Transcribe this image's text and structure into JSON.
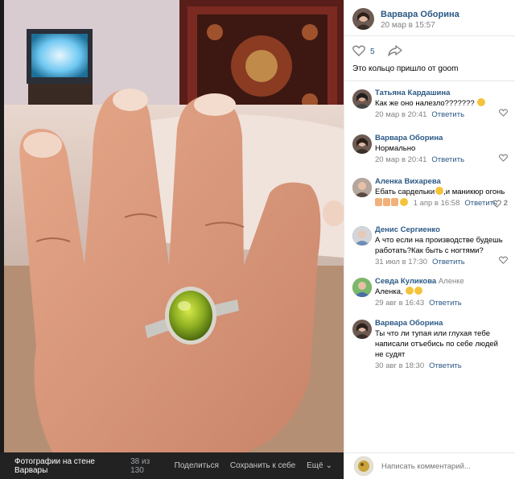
{
  "post": {
    "author_name": "Варвара Оборина",
    "date": "20 мар в 15:57",
    "likes": "5",
    "caption": "Это кольцо пришло от goom"
  },
  "comments": [
    {
      "name": "Татьяна Кардашина",
      "reply_to": "",
      "text": "Как же оно налезло???????",
      "date": "20 мар в 20:41",
      "reply": "Ответить",
      "likes": ""
    },
    {
      "name": "Варвара Оборина",
      "reply_to": "",
      "text": "Нормально",
      "date": "20 мар в 20:41",
      "reply": "Ответить",
      "likes": ""
    },
    {
      "name": "Аленка Вихарева",
      "reply_to": "",
      "text": "Ебать сардельки",
      "text2": ",и маникюр огонь",
      "date": "1 апр в 16:58",
      "reply": "Ответить",
      "likes": "2"
    },
    {
      "name": "Денис Сергиенко",
      "reply_to": "",
      "text": "А что если на производстве будешь работать?Как быть с ногтями?",
      "date": "31 июл в 17:30",
      "reply": "Ответить",
      "likes": ""
    },
    {
      "name": "Севда Куликова",
      "reply_to": "Аленке",
      "text": "Аленка,",
      "date": "29 авг в 16:43",
      "reply": "Ответить",
      "likes": ""
    },
    {
      "name": "Варвара Оборина",
      "reply_to": "",
      "text": "Ты что ли тупая или глухая тебе написали отъебись по себе людей не судят",
      "date": "30 авг в 18:30",
      "reply": "Ответить",
      "likes": ""
    }
  ],
  "viewer": {
    "album_title": "Фотографии на стене Варвары",
    "counter": "38 из 130",
    "share": "Поделиться",
    "save": "Сохранить к себе",
    "more": "Ещё"
  },
  "compose": {
    "placeholder": "Написать комментарий..."
  },
  "icons": {
    "like": "heart-icon",
    "share": "share-arrow-icon",
    "comment_like": "heart-icon",
    "more": "chevron-down-icon"
  },
  "colors": {
    "link": "#2a5885",
    "muted": "#828282",
    "viewer_bg": "#222222"
  }
}
